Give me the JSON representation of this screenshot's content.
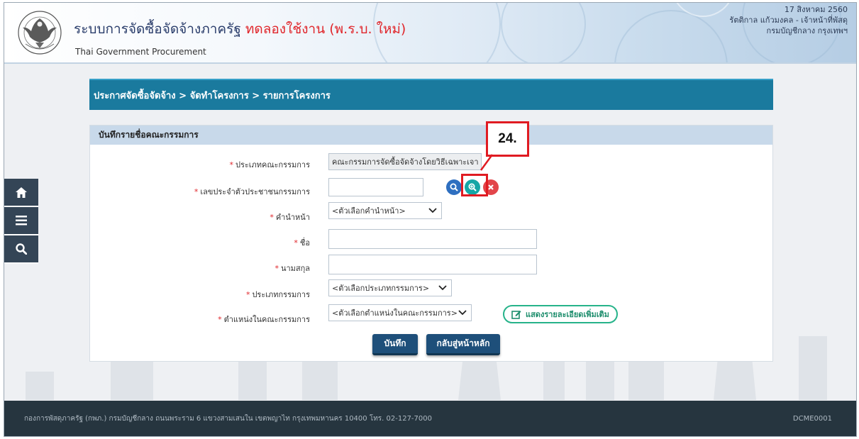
{
  "header": {
    "title_main": "ระบบการจัดซื้อจัดจ้างภาครัฐ",
    "title_trial": "ทดลองใช้งาน (พ.ร.บ. ใหม่)",
    "subtitle": "Thai Government Procurement",
    "date": "17 สิงหาคม 2560",
    "user": "รัตติกาล แก้วมงคล - เจ้าหน้าที่พัสดุ",
    "department": "กรมบัญชีกลาง กรุงเทพฯ",
    "logo_text": "กรมบัญชีกลาง"
  },
  "sidenav": {
    "items": [
      {
        "icon": "home-icon"
      },
      {
        "icon": "menu-icon"
      },
      {
        "icon": "search-icon"
      }
    ]
  },
  "breadcrumb": {
    "text": "ประกาศจัดซื้อจัดจ้าง > จัดทำโครงการ > รายการโครงการ"
  },
  "form": {
    "heading": "บันทึกรายชื่อคณะกรรมการ",
    "required_mark": "*",
    "committee_type_label": "ประเภทคณะกรรมการ",
    "committee_type_value": "คณะกรรมการจัดซื้อจัดจ้างโดยวิธีเฉพาะเจา",
    "id_label": "เลขประจำตัวประชาชนกรรมการ",
    "id_value": "",
    "prefix_label": "คำนำหน้า",
    "prefix_value": "<ตัวเลือกคำนำหน้า>",
    "firstname_label": "ชื่อ",
    "firstname_value": "",
    "lastname_label": "นามสกุล",
    "lastname_value": "",
    "member_type_label": "ประเภทกรรมการ",
    "member_type_value": "<ตัวเลือกประเภทกรรมการ>",
    "position_label": "ตำแหน่งในคณะกรรมการ",
    "position_value": "<ตัวเลือกตำแหน่งในคณะกรรมการ>",
    "details_button": "แสดงรายละเอียดเพิ่มเติม",
    "save_button": "บันทึก",
    "back_button": "กลับสู่หน้าหลัก"
  },
  "annotation": {
    "step": "24."
  },
  "footer": {
    "address": "กองการพัสดุภาครัฐ (กพภ.) กรมบัญชีกลาง ถนนพระราม 6 แขวงสามเสนใน เขตพญาไท กรุงเทพมหานคร 10400 โทร. 02-127-7000",
    "code": "DCME0001"
  },
  "colors": {
    "breadcrumb_bg": "#1a7a9e",
    "trial_red": "#e0262b",
    "footer_bg": "#26353f",
    "annotation_red": "#e01b22"
  }
}
